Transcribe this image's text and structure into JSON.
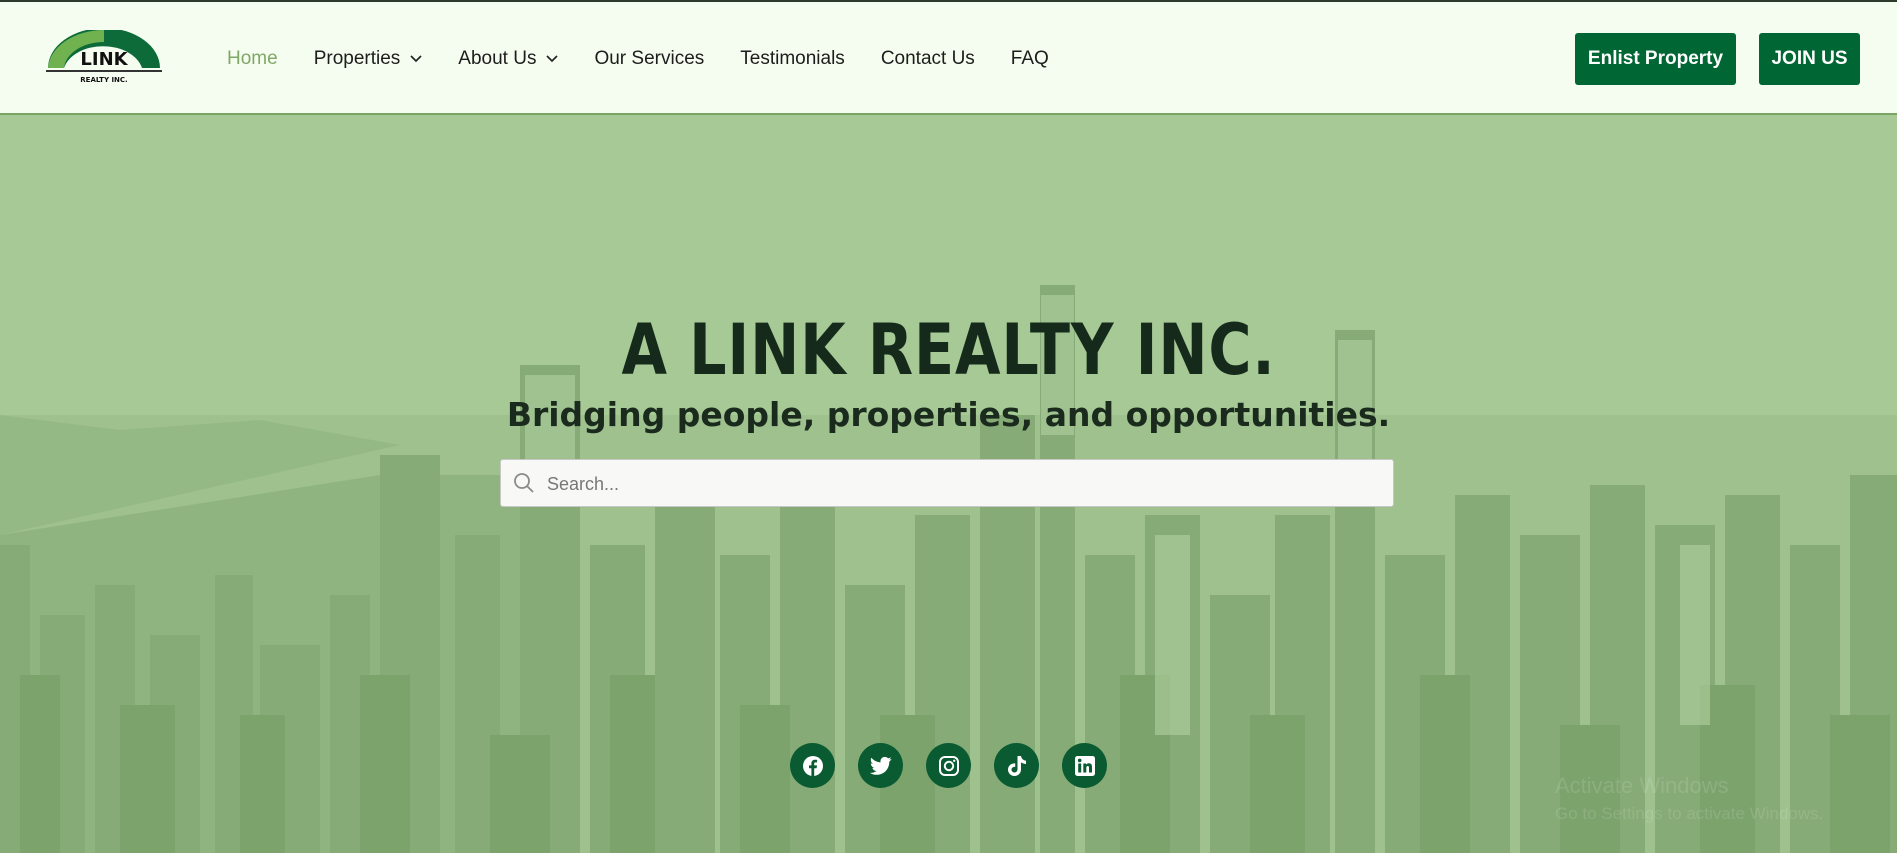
{
  "brand": {
    "logo_text": "LINK",
    "logo_subtext": "REALTY INC.",
    "colors": {
      "primary": "#006633",
      "accent": "#7fa866",
      "header_bg": "#f5fdf0",
      "hero_tint": "#a4c893"
    }
  },
  "nav": {
    "items": [
      {
        "label": "Home",
        "active": true
      },
      {
        "label": "Properties",
        "dropdown": true
      },
      {
        "label": "About Us",
        "dropdown": true
      },
      {
        "label": "Our Services"
      },
      {
        "label": "Testimonials"
      },
      {
        "label": "Contact Us"
      },
      {
        "label": "FAQ"
      }
    ]
  },
  "header_buttons": {
    "enlist": "Enlist Property",
    "join": "JOIN US"
  },
  "hero": {
    "title": "A LINK REALTY INC.",
    "subtitle": "Bridging people, properties, and opportunities.",
    "search": {
      "placeholder": "Search...",
      "value": ""
    }
  },
  "social": [
    "facebook-icon",
    "twitter-icon",
    "instagram-icon",
    "tiktok-icon",
    "linkedin-icon"
  ],
  "watermark": {
    "line1": "Activate Windows",
    "line2": "Go to Settings to activate Windows."
  }
}
